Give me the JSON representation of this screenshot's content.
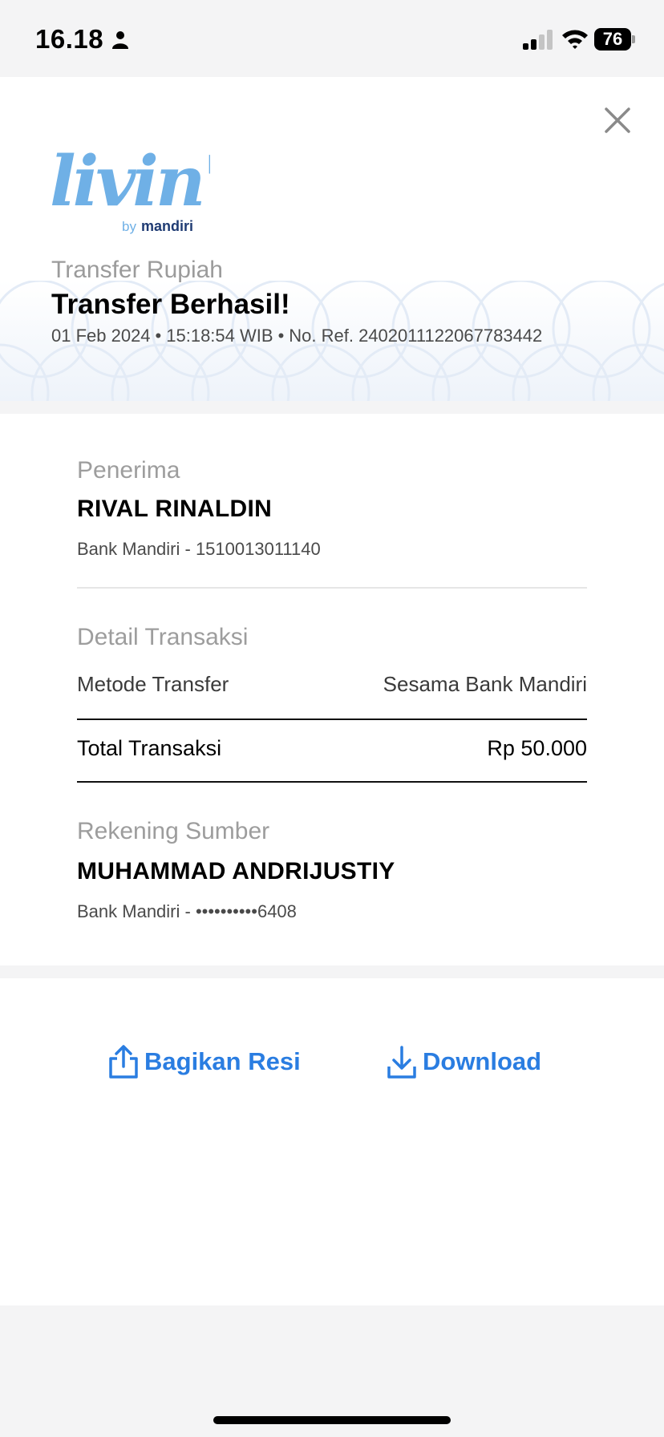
{
  "status_bar": {
    "time": "16.18",
    "battery": "76"
  },
  "header": {
    "logo_text": "livin'",
    "logo_sub_prefix": "by",
    "logo_sub_brand": "mandiri",
    "subtitle": "Transfer Rupiah",
    "title": "Transfer Berhasil!",
    "date": "01 Feb 2024",
    "time": "15:18:54 WIB",
    "reference": "No. Ref. 2402011122067783442"
  },
  "recipient": {
    "section_label": "Penerima",
    "name": "RIVAL RINALDIN",
    "account": "Bank Mandiri - 1510013011140"
  },
  "transaction": {
    "section_label": "Detail Transaksi",
    "method_label": "Metode Transfer",
    "method_value": "Sesama Bank Mandiri",
    "total_label": "Total Transaksi",
    "total_value": "Rp 50.000"
  },
  "source": {
    "section_label": "Rekening Sumber",
    "name": "MUHAMMAD ANDRIJUSTIY",
    "account": "Bank Mandiri - ••••••••••6408"
  },
  "actions": {
    "share_label": "Bagikan Resi",
    "download_label": "Download"
  },
  "colors": {
    "accent": "#2a7de1",
    "logo_blue": "#6fb0e6",
    "logo_yellow": "#f2b632",
    "brand_navy": "#1f3b73"
  }
}
